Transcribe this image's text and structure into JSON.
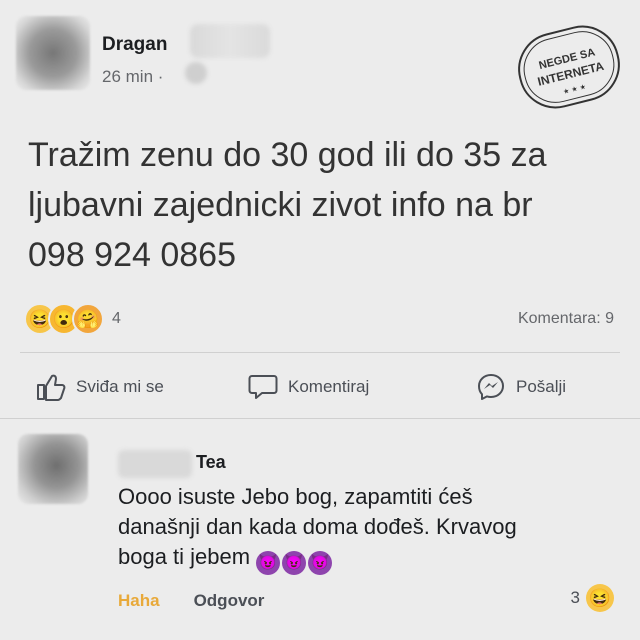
{
  "post": {
    "author": "Dragan",
    "time": "26 min · ",
    "text": "Tražim zenu do 30 god ili do 35 za\nljubavni zajednicki zivot info na br\n098 924 0865",
    "reactions": {
      "icons": [
        "haha-emoji-icon",
        "wow-emoji-icon",
        "care-emoji-icon"
      ],
      "count": "4"
    },
    "comments_count": "Komentara: 9",
    "actions": {
      "like": "Sviđa mi se",
      "comment": "Komentiraj",
      "share": "Pošalji"
    }
  },
  "stamp": {
    "line1": "NEGDE SA",
    "line2": "INTERNETA"
  },
  "comment": {
    "author": "Tea",
    "text": "Oooo isuste Jebo bog, zapamtiti ćeš\ndanašnji dan kada doma dođeš. Krvavog\nboga ti jebem",
    "emojis": [
      "devil-emoji-icon",
      "devil-emoji-icon",
      "devil-emoji-icon"
    ],
    "haha_label": "Haha",
    "reply_label": "Odgovor",
    "reaction_count": "3"
  },
  "colors": {
    "background": "#ececec",
    "secondary_text": "#65676b",
    "haha_link": "#e8a93a",
    "devil": "#8e44ad"
  }
}
